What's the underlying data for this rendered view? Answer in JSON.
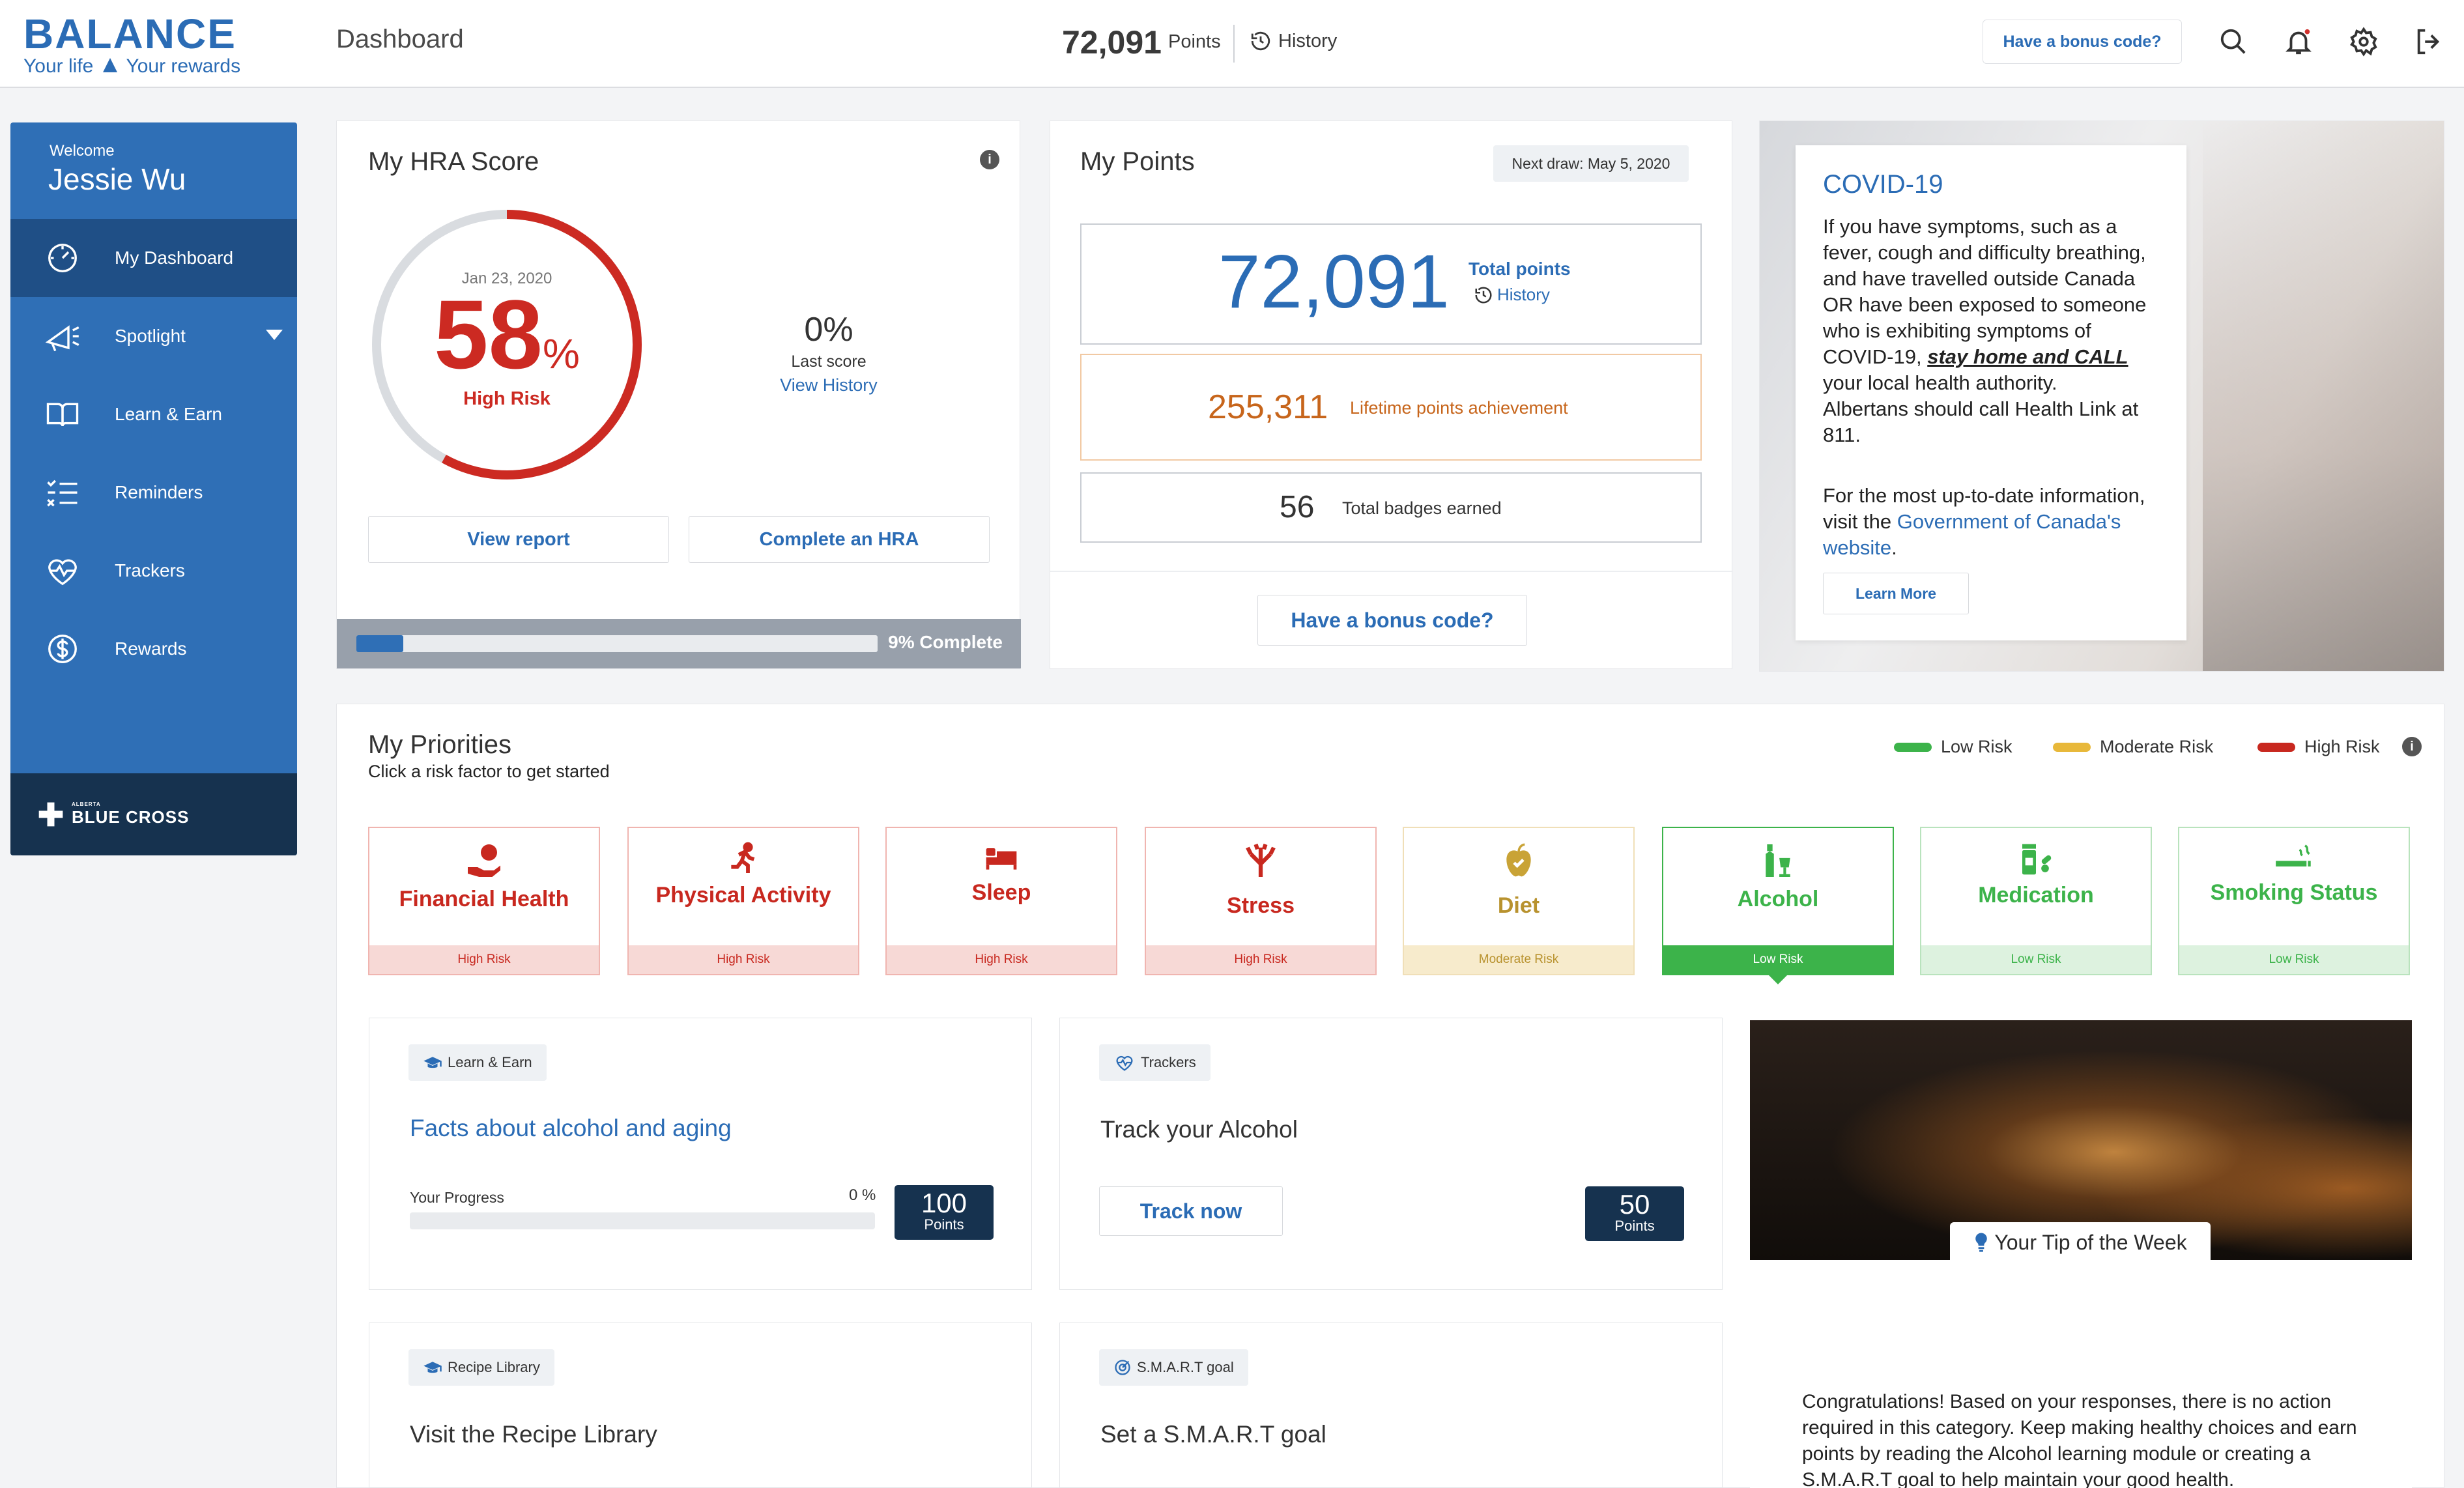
{
  "header": {
    "brand": "BALANCE",
    "tagline_left": "Your life",
    "tagline_right": "Your rewards",
    "page_title": "Dashboard",
    "points_value": "72,091",
    "points_label": "Points",
    "history_label": "History",
    "bonus_code_label": "Have a bonus code?",
    "icons": [
      "search-icon",
      "bell-icon",
      "gear-icon",
      "logout-icon"
    ]
  },
  "sidebar": {
    "welcome": "Welcome",
    "user_name": "Jessie Wu",
    "items": [
      {
        "label": "My Dashboard",
        "icon": "dashboard-icon",
        "active": true
      },
      {
        "label": "Spotlight",
        "icon": "megaphone-icon",
        "active": false
      },
      {
        "label": "Learn & Earn",
        "icon": "book-icon",
        "active": false
      },
      {
        "label": "Reminders",
        "icon": "checklist-icon",
        "active": false
      },
      {
        "label": "Trackers",
        "icon": "heartbeat-icon",
        "active": false
      },
      {
        "label": "Rewards",
        "icon": "dollar-icon",
        "active": false
      }
    ],
    "footer_brand_small": "ALBERTA",
    "footer_brand": "BLUE CROSS"
  },
  "hra": {
    "title": "My HRA Score",
    "date": "Jan 23, 2020",
    "score": "58",
    "score_unit": "%",
    "score_fraction": 0.58,
    "risk": "High Risk",
    "last_score_value": "0%",
    "last_score_label": "Last score",
    "view_history": "View History",
    "view_report": "View report",
    "complete_hra": "Complete an HRA",
    "progress_fraction": 0.09,
    "progress_label": "9% Complete"
  },
  "points": {
    "title": "My Points",
    "next_draw": "Next draw: May 5, 2020",
    "total_value": "72,091",
    "total_label": "Total points",
    "history_label": "History",
    "lifetime_value": "255,311",
    "lifetime_label": "Lifetime points achievement",
    "badges_value": "56",
    "badges_label": "Total badges earned",
    "bonus_label": "Have a bonus code?"
  },
  "covid": {
    "title": "COVID-19",
    "p1_a": "If you have symptoms, such as a fever, cough and difficulty breathing, and have travelled outside Canada OR have been exposed to someone who is exhibiting symptoms of COVID-19,",
    "p1_link": "stay home and CALL",
    "p1_b": "your local health authority.",
    "p1_c": "Albertans should call Health Link at 811.",
    "p2_a": "For the most up-to-date information, visit the",
    "p2_link": "Government of Canada's website",
    "p2_b": ".",
    "learn_more": "Learn More"
  },
  "priorities": {
    "title": "My Priorities",
    "subtitle": "Click a risk factor to get started",
    "legend": [
      {
        "label": "Low Risk",
        "color": "#3cb34a"
      },
      {
        "label": "Moderate Risk",
        "color": "#e8b83a"
      },
      {
        "label": "High Risk",
        "color": "#c8281f"
      }
    ],
    "factors": [
      {
        "label": "Financial Health",
        "risk": "High Risk",
        "icon": "money-hand-icon"
      },
      {
        "label": "Physical Activity",
        "risk": "High Risk",
        "icon": "running-icon"
      },
      {
        "label": "Sleep",
        "risk": "High Risk",
        "icon": "bed-icon"
      },
      {
        "label": "Stress",
        "risk": "High Risk",
        "icon": "stress-icon"
      },
      {
        "label": "Diet",
        "risk": "Moderate Risk",
        "icon": "apple-icon"
      },
      {
        "label": "Alcohol",
        "risk": "Low Risk",
        "icon": "bottle-glass-icon",
        "selected": true
      },
      {
        "label": "Medication",
        "risk": "Low Risk",
        "icon": "pill-bottle-icon"
      },
      {
        "label": "Smoking Status",
        "risk": "Low Risk",
        "icon": "cigarette-icon"
      }
    ]
  },
  "tiles": {
    "learn": {
      "tag": "Learn & Earn",
      "title": "Facts about alcohol and aging",
      "progress_label": "Your Progress",
      "progress_value": "0 %",
      "progress_fraction": 0,
      "points": "100",
      "points_unit": "Points"
    },
    "trackers": {
      "tag": "Trackers",
      "title": "Track your Alcohol",
      "button": "Track now",
      "points": "50",
      "points_unit": "Points"
    },
    "recipe": {
      "tag": "Recipe Library",
      "title": "Visit the Recipe Library"
    },
    "smart": {
      "tag": "S.M.A.R.T goal",
      "title": "Set a S.M.A.R.T goal"
    },
    "tip": {
      "label": "Your Tip of the Week",
      "text": "Congratulations! Based on your responses, there is no action required in this category. Keep making healthy choices and earn points by reading the Alcohol learning module or creating a S.M.A.R.T goal to help maintain your good health."
    }
  }
}
